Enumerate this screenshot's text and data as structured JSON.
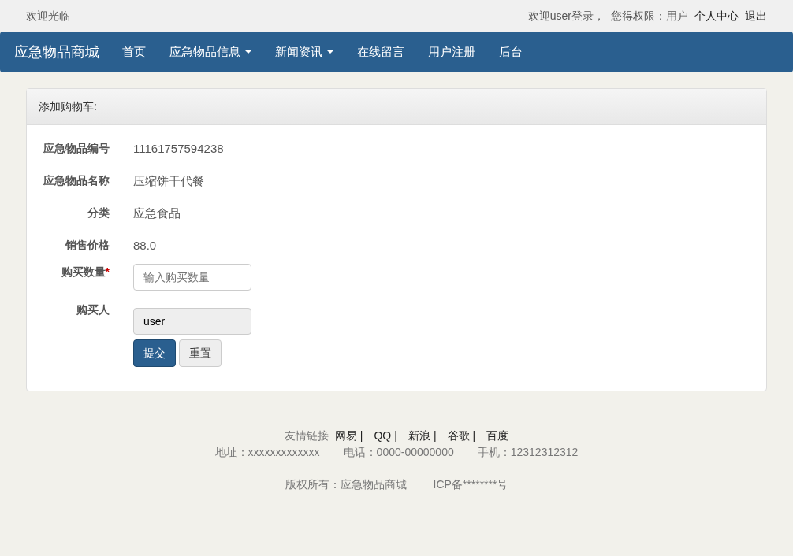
{
  "top_bar": {
    "welcome": "欢迎光临",
    "user_greeting": "欢迎user登录，",
    "permission": "您得权限：用户",
    "links": [
      "个人中心",
      "退出"
    ]
  },
  "navbar": {
    "brand": "应急物品商城",
    "items": [
      {
        "label": "首页",
        "dropdown": false
      },
      {
        "label": "应急物品信息",
        "dropdown": true
      },
      {
        "label": "新闻资讯",
        "dropdown": true
      },
      {
        "label": "在线留言",
        "dropdown": false
      },
      {
        "label": "用户注册",
        "dropdown": false
      },
      {
        "label": "后台",
        "dropdown": false
      }
    ]
  },
  "panel": {
    "title": "添加购物车:",
    "fields": [
      {
        "kind": "text",
        "label": "应急物品编号",
        "value": "11161757594238"
      },
      {
        "kind": "text",
        "label": "应急物品名称",
        "value": "压缩饼干代餐"
      },
      {
        "kind": "text",
        "label": "分类",
        "value": "应急食品"
      },
      {
        "kind": "text",
        "label": "销售价格",
        "value": "88.0"
      },
      {
        "kind": "input",
        "label": "购买数量",
        "required_mark": "*",
        "placeholder": "输入购买数量"
      },
      {
        "kind": "readonly",
        "label": "购买人",
        "value": "user"
      }
    ],
    "buttons": [
      {
        "label": "提交",
        "kind": "primary"
      },
      {
        "label": "重置",
        "kind": "default"
      }
    ]
  },
  "footer": {
    "links_label": "友情链接",
    "separator": "|",
    "links": [
      "网易",
      "QQ",
      "新浪",
      "谷歌",
      "百度"
    ],
    "contacts": [
      "地址：xxxxxxxxxxxxx",
      "电话：0000-00000000",
      "手机：12312312312"
    ],
    "copyright": [
      "版权所有：应急物品商城",
      "ICP备********号"
    ]
  }
}
